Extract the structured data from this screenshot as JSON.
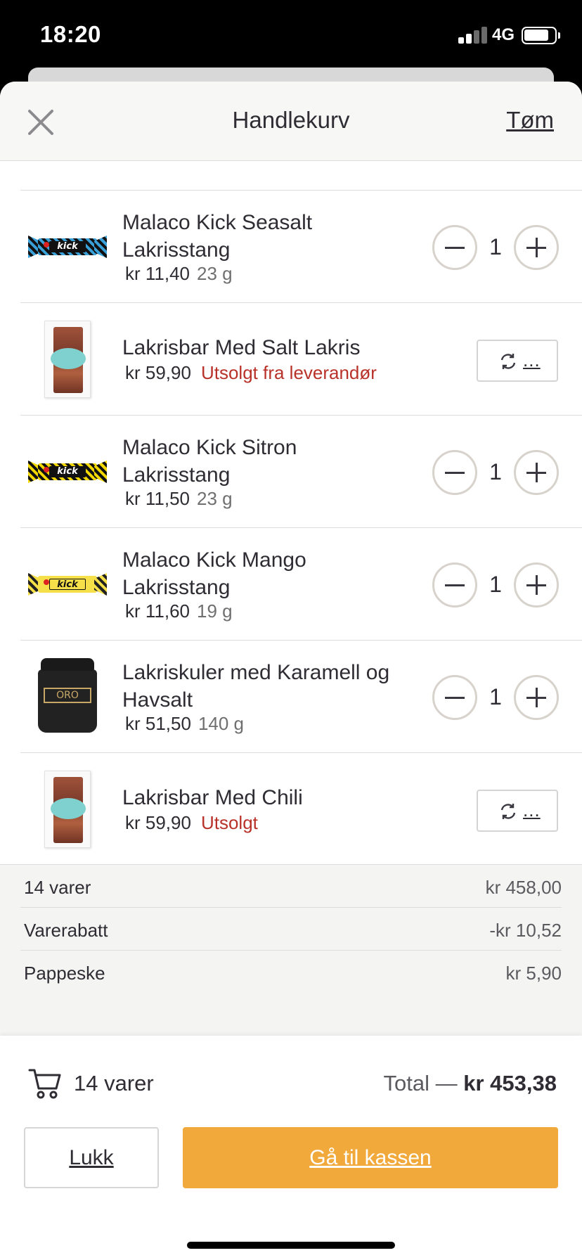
{
  "status_bar": {
    "time": "18:20",
    "network": "4G"
  },
  "header": {
    "title": "Handlekurv",
    "clear_label": "Tøm"
  },
  "items": [
    {
      "name": "Malaco Kick Seasalt Lakrisstang",
      "price": "kr 11,40",
      "weight": "23 g",
      "quantity": "1",
      "thumb": "kick-seasalt-candy"
    },
    {
      "name": "Lakrisbar Med Salt Lakris",
      "price": "kr 59,90",
      "status": "Utsolgt fra leverandør",
      "replace_label": "...",
      "thumb": "chocolate-bar-pack"
    },
    {
      "name": "Malaco Kick Sitron Lakrisstang",
      "price": "kr 11,50",
      "weight": "23 g",
      "quantity": "1",
      "thumb": "kick-sitron-candy"
    },
    {
      "name": "Malaco Kick Mango Lakrisstang",
      "price": "kr 11,60",
      "weight": "19 g",
      "quantity": "1",
      "thumb": "kick-mango-candy"
    },
    {
      "name": "Lakriskuler med Karamell og Havsalt",
      "price": "kr 51,50",
      "weight": "140 g",
      "quantity": "1",
      "thumb": "oro-jar"
    },
    {
      "name": "Lakrisbar Med Chili",
      "price": "kr 59,90",
      "status": "Utsolgt",
      "replace_label": "...",
      "thumb": "chocolate-bar-pack"
    }
  ],
  "thumb_text": {
    "kick": "kick",
    "oro": "ORO"
  },
  "summary": [
    {
      "label": "14 varer",
      "value": "kr 458,00"
    },
    {
      "label": "Varerabatt",
      "value": "-kr 10,52"
    },
    {
      "label": "Pappeske",
      "value": "kr 5,90"
    }
  ],
  "footer": {
    "count_label": "14 varer",
    "total_label": "Total —",
    "total_value": "kr 453,38",
    "close_label": "Lukk",
    "checkout_label": "Gå til kassen"
  },
  "colors": {
    "accent": "#f2a93b",
    "sold_out": "#b9322a",
    "text": "#2f2c33",
    "kick_seasalt": "#3aa0d8",
    "kick_sitron": "#f2d800",
    "kick_mango": "#f5e04a"
  }
}
